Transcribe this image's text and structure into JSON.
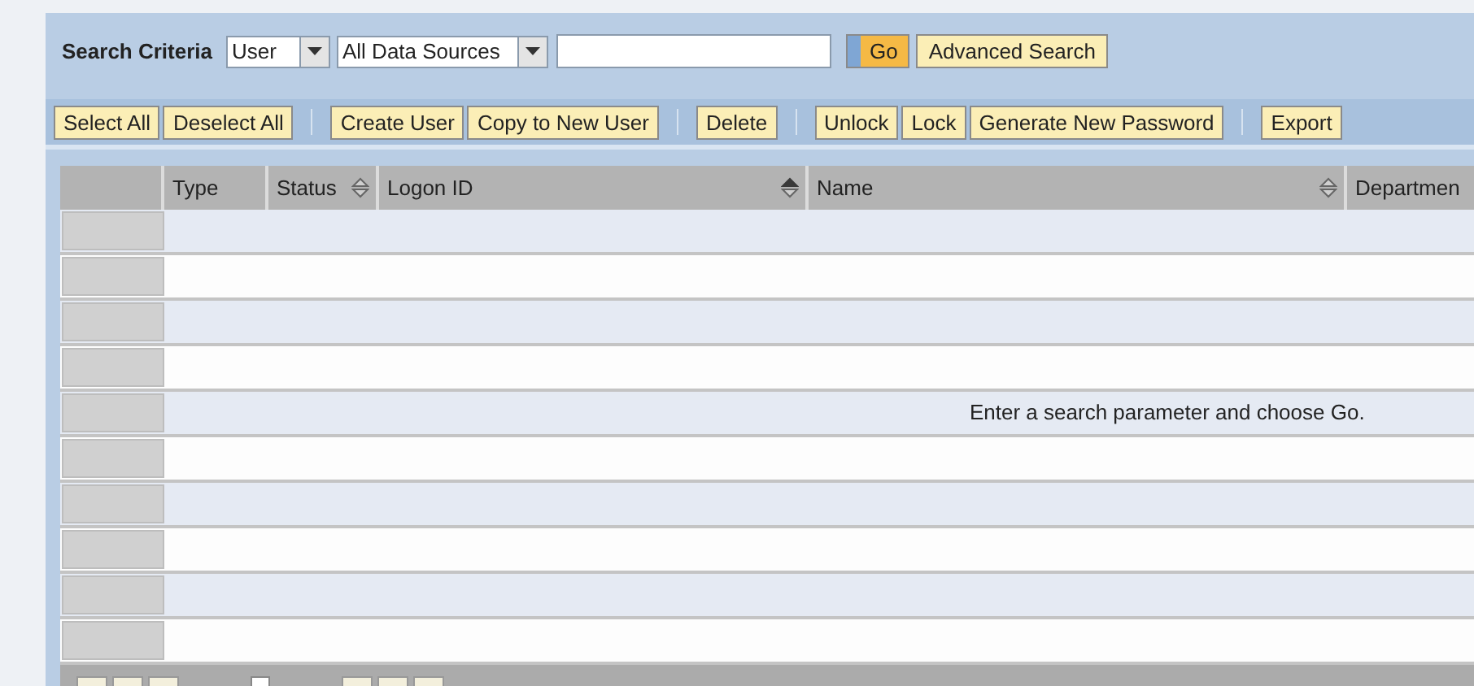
{
  "search": {
    "label": "Search Criteria",
    "type_select": "User",
    "source_select": "All Data Sources",
    "go_button": "Go",
    "advanced_button": "Advanced Search"
  },
  "toolbar": [
    [
      "Select All",
      "Deselect All"
    ],
    [
      "Create User",
      "Copy to New User"
    ],
    [
      "Delete"
    ],
    [
      "Unlock",
      "Lock",
      "Generate New Password"
    ],
    [
      "Export"
    ]
  ],
  "table": {
    "columns": [
      {
        "label": "Type",
        "sortable": false
      },
      {
        "label": "Status",
        "sortable": true,
        "sorted": false
      },
      {
        "label": "Logon ID",
        "sortable": true,
        "sorted": true
      },
      {
        "label": "Name",
        "sortable": true,
        "sorted": false
      },
      {
        "label": "Departmen",
        "sortable": false
      }
    ],
    "empty_message": "Enter a search parameter and choose Go."
  }
}
